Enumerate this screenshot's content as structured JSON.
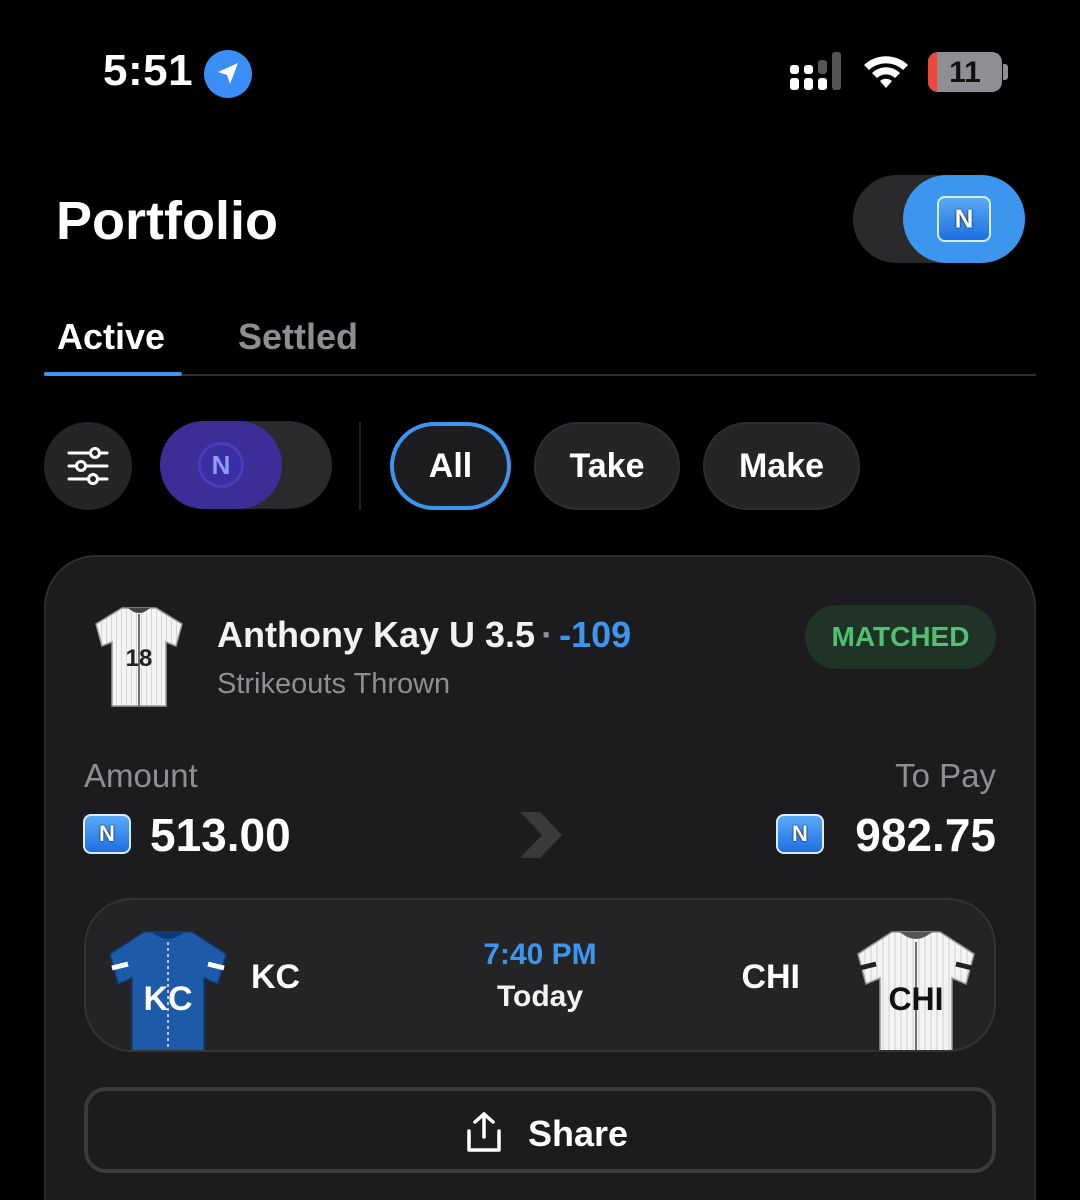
{
  "status_bar": {
    "time": "5:51",
    "battery": "11",
    "icons": [
      "location-icon",
      "cellular-signal-icon",
      "wifi-icon",
      "battery-icon"
    ]
  },
  "header": {
    "title": "Portfolio",
    "currency_toggle_icon": "coin-icon"
  },
  "tabs": [
    {
      "label": "Active",
      "selected": true
    },
    {
      "label": "Settled",
      "selected": false
    }
  ],
  "filters": {
    "filter_icon": "sliders-icon",
    "mode_toggle_icon": "token-n-icon",
    "pills": [
      {
        "label": "All",
        "selected": true
      },
      {
        "label": "Take",
        "selected": false
      },
      {
        "label": "Make",
        "selected": false
      }
    ]
  },
  "bet_card": {
    "player_jersey_number": "18",
    "selection": "Anthony Kay U 3.5",
    "separator": "·",
    "odds": "-109",
    "market": "Strikeouts Thrown",
    "status": "MATCHED",
    "amount_label": "Amount",
    "amount_value": "513.00",
    "to_pay_label": "To Pay",
    "to_pay_value": "982.75",
    "game": {
      "home_team": "KC",
      "home_jersey_text": "KC",
      "away_team": "CHI",
      "away_jersey_text": "CHI",
      "time": "7:40 PM",
      "day": "Today"
    },
    "share_label": "Share"
  },
  "colors": {
    "accent": "#3d96ee",
    "matched_green": "#52c071",
    "background": "#000000",
    "card": "#1c1c1e",
    "mode_purple": "#3c2e96"
  }
}
